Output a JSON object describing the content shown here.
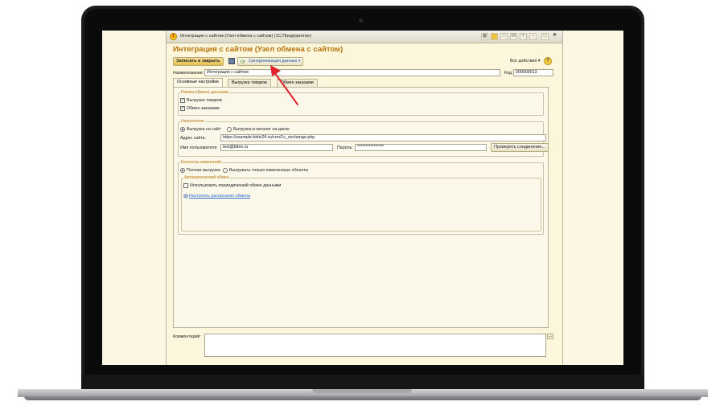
{
  "window": {
    "title": "Интеграция с сайтом (Узел обмена с сайтом)  (1С:Предприятие)",
    "heading": "Интеграция с сайтом (Узел обмена с сайтом)"
  },
  "toolbar": {
    "save_close_label": "Записать и закрыть",
    "sync_label": "Синхронизация данных",
    "all_actions_label": "Все действия",
    "help_label": "?"
  },
  "form": {
    "name_label": "Наименование:",
    "name_value": "Интеграция с сайтом",
    "code_label": "Код:",
    "code_value": "000000013"
  },
  "tabs": [
    {
      "label": "Основные настройки"
    },
    {
      "label": "Выгрузка товаров"
    },
    {
      "label": "Обмен заказами"
    }
  ],
  "exchange_mode": {
    "title": "Режим обмена данными",
    "options": [
      {
        "label": "Выгрузка товаров",
        "checked": true
      },
      {
        "label": "Обмен заказами",
        "checked": true
      }
    ]
  },
  "destination": {
    "title": "Назначение",
    "options": [
      {
        "label": "Выгрузка на сайт",
        "selected": true
      },
      {
        "label": "Выгрузка в каталог на диске",
        "selected": false
      }
    ],
    "site_label": "Адрес сайта:",
    "site_value": "https://example.bitrix24.ru/crm/1c_exchange.php",
    "user_label": "Имя пользователя:",
    "user_value": "test@bitrix.ru",
    "password_label": "Пароль:",
    "password_value": "****************",
    "check_button": "Проверить соединение..."
  },
  "change_control": {
    "title": "Контроль изменений",
    "options": [
      {
        "label": "Полная выгрузка",
        "selected": true
      },
      {
        "label": "Выгружать только измененные объекты",
        "selected": false
      }
    ]
  },
  "auto_exchange": {
    "title": "Автоматический обмен",
    "checkbox_label": "Использовать периодический обмен данными",
    "checked": false,
    "schedule_link": "Настроить расписание обмена"
  },
  "comment": {
    "label": "Комментарий:",
    "value": ""
  },
  "colors": {
    "heading": "#b9740b",
    "link": "#2f6fd1",
    "annotation_arrow": "#e0202a",
    "window_background": "#fbf6dc"
  },
  "annotation": {
    "icon": "red-arrow-icon"
  }
}
